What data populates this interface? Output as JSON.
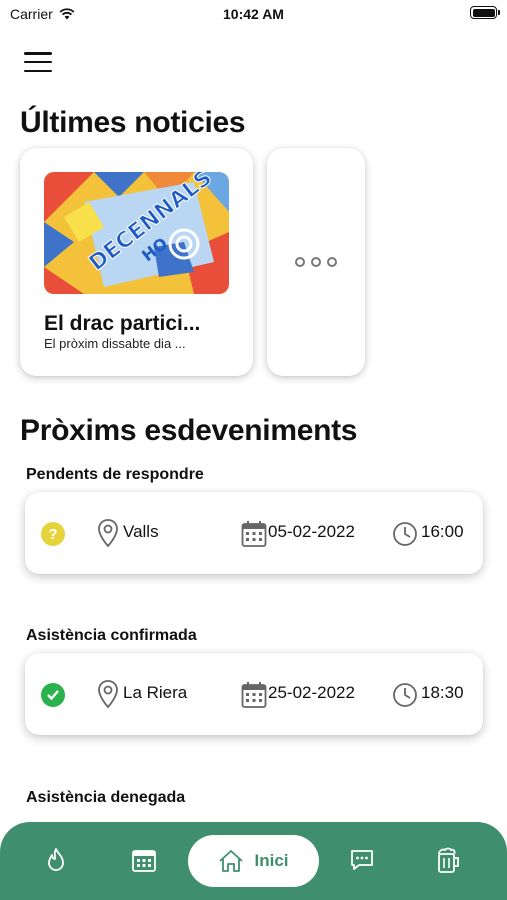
{
  "status_bar": {
    "carrier": "Carrier",
    "time": "10:42 AM"
  },
  "header": {
    "menu_icon": "hamburger-menu-icon"
  },
  "news": {
    "title": "Últimes noticies",
    "cards": [
      {
        "headline": "El drac partici...",
        "excerpt": "El pròxim dissabte dia ...",
        "image_text": "DECENNALS",
        "image_subtext": "HO"
      }
    ],
    "more_icon": "ellipsis-icon"
  },
  "events": {
    "title": "Pròxims esdeveniments",
    "groups": [
      {
        "label": "Pendents de respondre",
        "status_icon": "question-icon",
        "status_color": "#e5d33c",
        "location": "Valls",
        "date": "05-02-2022",
        "time": "16:00"
      },
      {
        "label": "Asistència confirmada",
        "status_icon": "check-icon",
        "status_color": "#2bb24c",
        "location": "La Riera",
        "date": "25-02-2022",
        "time": "18:30"
      },
      {
        "label": "Asistència denegada"
      }
    ]
  },
  "tab_bar": {
    "active_label": "Inici",
    "color": "#3f8f6e",
    "items": [
      "fire-icon",
      "calendar-icon",
      "home-icon",
      "chat-icon",
      "beer-icon"
    ]
  }
}
